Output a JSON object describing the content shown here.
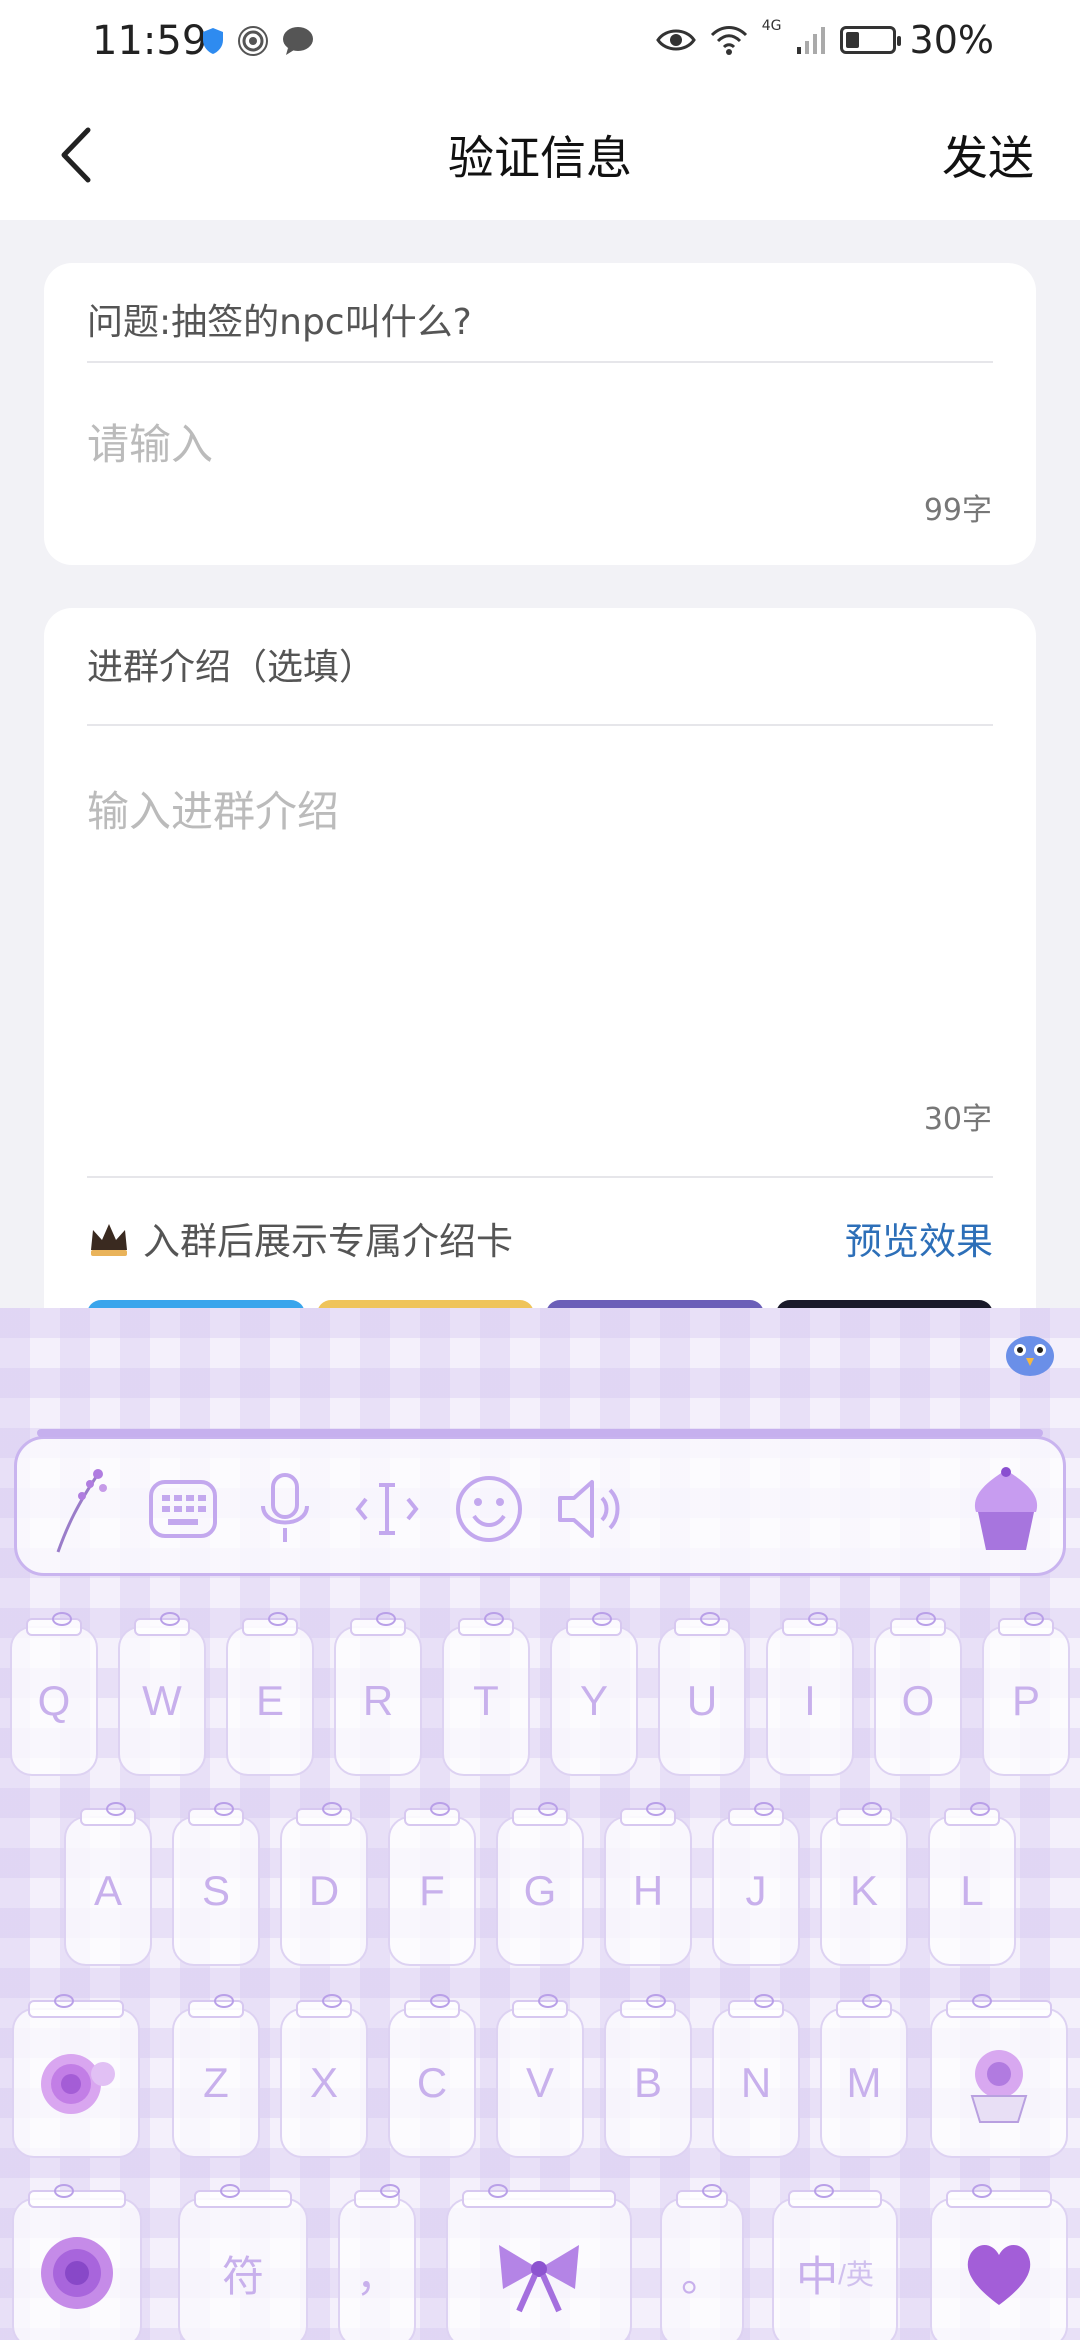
{
  "status_bar": {
    "time": "11:59",
    "battery_text": "30%",
    "battery_level": 0.3,
    "network": "4G"
  },
  "header": {
    "title": "验证信息",
    "send_label": "发送"
  },
  "question_card": {
    "question": "问题:抽签的npc叫什么?",
    "answer_placeholder": "请输入",
    "char_limit": "99字"
  },
  "intro_card": {
    "label": "进群介绍（选填）",
    "placeholder": "输入进群介绍",
    "char_limit": "30字",
    "feature_text": "入群后展示专属介绍卡",
    "preview_label": "预览效果",
    "card_styles": [
      "#3aa5ec",
      "#efc45a",
      "#6b5fb8",
      "#1a1a2a"
    ]
  },
  "keyboard": {
    "theme_colors": {
      "key_text": "#c8b0ec",
      "accent": "#b48ee6"
    },
    "toolbar_icons": [
      "flower-branch-icon",
      "keyboard-icon",
      "microphone-icon",
      "cursor-icon",
      "emoji-icon",
      "speaker-icon",
      "cupcake-icon"
    ],
    "row1": [
      "Q",
      "W",
      "E",
      "R",
      "T",
      "Y",
      "U",
      "I",
      "O",
      "P"
    ],
    "row2": [
      "A",
      "S",
      "D",
      "F",
      "G",
      "H",
      "J",
      "K",
      "L"
    ],
    "row3": [
      "Z",
      "X",
      "C",
      "V",
      "B",
      "N",
      "M"
    ],
    "symbol_key": "符",
    "comma_key": "，",
    "period_key": "。",
    "lang_key_main": "中",
    "lang_key_sub": "/英"
  }
}
